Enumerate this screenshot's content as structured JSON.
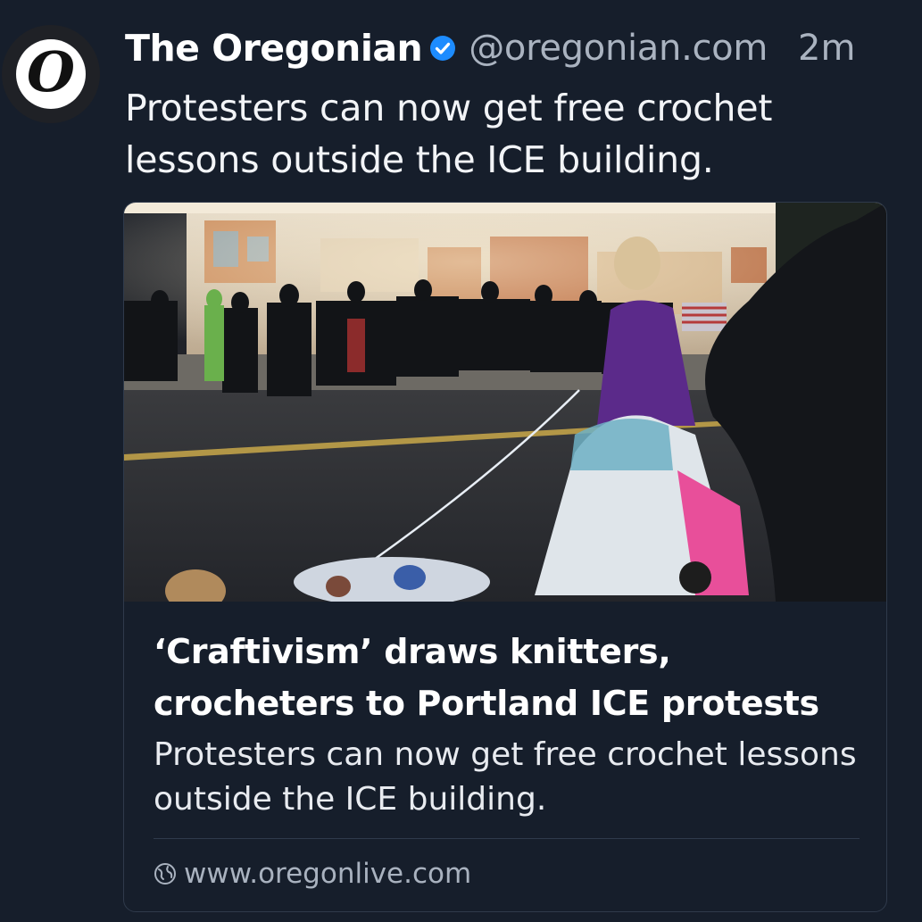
{
  "post": {
    "author": {
      "name": "The Oregonian",
      "handle": "@oregonian.com",
      "avatar_letter": "O",
      "verified": true
    },
    "timestamp": "2m",
    "text": "Protesters can now get free crochet lessons outside the ICE building.",
    "link_card": {
      "image_icon": "news-photo",
      "title": "‘Craftivism’ draws knitters, crocheters to Portland ICE protests",
      "description": "Protesters can now get free crochet lessons outside the ICE building.",
      "domain": "www.oregonlive.com",
      "domain_icon": "globe-icon"
    }
  },
  "colors": {
    "background": "#161e2b",
    "verified_badge": "#1d8cff",
    "muted_text": "#aab3c0",
    "card_border": "#2f3a4b"
  }
}
